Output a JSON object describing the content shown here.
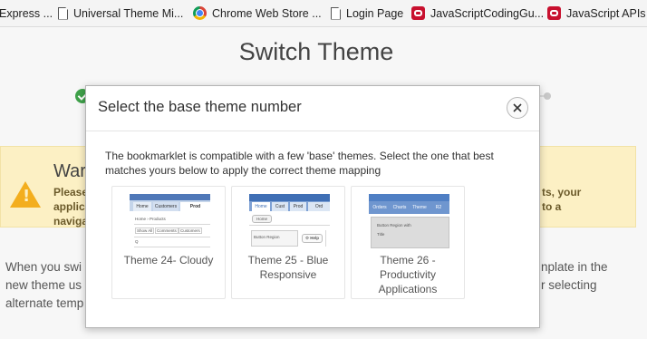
{
  "bookmarks": [
    {
      "label": "Express ...",
      "icon": "none"
    },
    {
      "label": "Universal Theme Mi...",
      "icon": "page-icon"
    },
    {
      "label": "Chrome Web Store ...",
      "icon": "chrome-store-icon"
    },
    {
      "label": "Login Page",
      "icon": "page-icon"
    },
    {
      "label": "JavaScriptCodingGu...",
      "icon": "oracle-icon"
    },
    {
      "label": "JavaScript APIs",
      "icon": "oracle-icon"
    }
  ],
  "page": {
    "title": "Switch Theme",
    "warning": {
      "title": "War",
      "text_left": "Please applica naviga",
      "text_right": "ts, your\nto a"
    },
    "body_left": "When you swi\nnew theme us\nalternate temp",
    "body_right": "nplate in the\nr selecting"
  },
  "modal": {
    "title": "Select the base theme number",
    "close_icon": "close-icon",
    "description": "The bookmarklet is compatible with a few 'base' themes. Select the one that best matches yours below to apply the correct theme mapping",
    "themes": [
      {
        "label": "Theme 24- Cloudy"
      },
      {
        "label": "Theme 25 - Blue Responsive"
      },
      {
        "label": "Theme 26 - Productivity Applications"
      }
    ]
  },
  "colors": {
    "success": "#3fa14a",
    "warning_bg": "#fcf0c4",
    "warning_icon": "#f3ae1e",
    "thumb_blue": "#5b87c8"
  }
}
